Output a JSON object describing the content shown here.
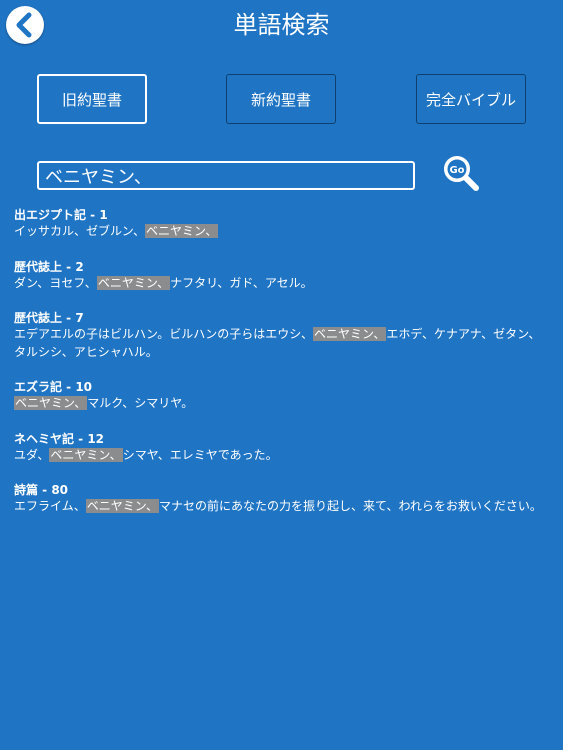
{
  "header": {
    "title": "単語検索"
  },
  "tabs": [
    {
      "label": "旧約聖書",
      "selected": true
    },
    {
      "label": "新約聖書",
      "selected": false
    },
    {
      "label": "完全バイブル",
      "selected": false
    }
  ],
  "search": {
    "value": "ベニヤミン、",
    "go_label": "Go"
  },
  "results": [
    {
      "ref": "出エジプト記 - 1",
      "segments": [
        {
          "t": "イッサカル、ゼブルン、"
        },
        {
          "t": "ベニヤミン、",
          "hl": true
        }
      ]
    },
    {
      "ref": "歴代誌上 - 2",
      "segments": [
        {
          "t": "ダン、ヨセフ、"
        },
        {
          "t": "ベニヤミン、",
          "hl": true
        },
        {
          "t": "ナフタリ、ガド、アセル。"
        }
      ]
    },
    {
      "ref": "歴代誌上 - 7",
      "segments": [
        {
          "t": "エデアエルの子はビルハン。ビルハンの子らはエウシ、"
        },
        {
          "t": "ベニヤミン、",
          "hl": true
        },
        {
          "t": "エホデ、ケナアナ、ゼタン、タルシシ、アヒシャハル。"
        }
      ]
    },
    {
      "ref": "エズラ記 - 10",
      "segments": [
        {
          "t": "ベニヤミン、",
          "hl": true
        },
        {
          "t": "マルク、シマリヤ。"
        }
      ]
    },
    {
      "ref": "ネヘミヤ記 - 12",
      "segments": [
        {
          "t": "ユダ、"
        },
        {
          "t": "ベニヤミン、",
          "hl": true
        },
        {
          "t": "シマヤ、エレミヤであった。"
        }
      ]
    },
    {
      "ref": "詩篇 - 80",
      "segments": [
        {
          "t": "エフライム、"
        },
        {
          "t": "ベニヤミン、",
          "hl": true
        },
        {
          "t": "マナセの前にあなたの力を振り起し、来て、われらをお救いください。"
        }
      ]
    }
  ]
}
